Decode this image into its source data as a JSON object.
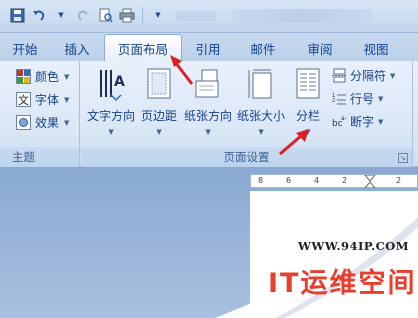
{
  "tabs": [
    {
      "label": "开始"
    },
    {
      "label": "插入"
    },
    {
      "label": "页面布局",
      "active": true
    },
    {
      "label": "引用"
    },
    {
      "label": "邮件"
    },
    {
      "label": "审阅"
    },
    {
      "label": "视图"
    }
  ],
  "theme_group": {
    "items": [
      {
        "label": "颜色",
        "icon": "color-palette-icon"
      },
      {
        "label": "字体",
        "icon": "font-icon"
      },
      {
        "label": "效果",
        "icon": "effects-icon"
      }
    ],
    "label": "主题"
  },
  "page_setup_group": {
    "big_buttons": [
      {
        "label": "文字方向",
        "icon": "text-direction-icon"
      },
      {
        "label": "页边距",
        "icon": "margins-icon"
      },
      {
        "label": "纸张方向",
        "icon": "orientation-icon"
      },
      {
        "label": "纸张大小",
        "icon": "paper-size-icon"
      },
      {
        "label": "分栏",
        "icon": "columns-icon"
      }
    ],
    "small_items": [
      {
        "label": "分隔符",
        "icon": "breaks-icon"
      },
      {
        "label": "行号",
        "icon": "line-numbers-icon"
      },
      {
        "label": "断字",
        "icon": "hyphenation-icon"
      }
    ],
    "label": "页面设置"
  },
  "ruler": {
    "ticks": [
      "8",
      "6",
      "4",
      "2",
      "2"
    ]
  },
  "watermark": {
    "url": "WWW.94IP.COM",
    "title": "IT运维空间"
  },
  "colors": {
    "ribbon_text": "#15428b",
    "arrow": "#e02020",
    "watermark_title": "#e83e2e"
  }
}
